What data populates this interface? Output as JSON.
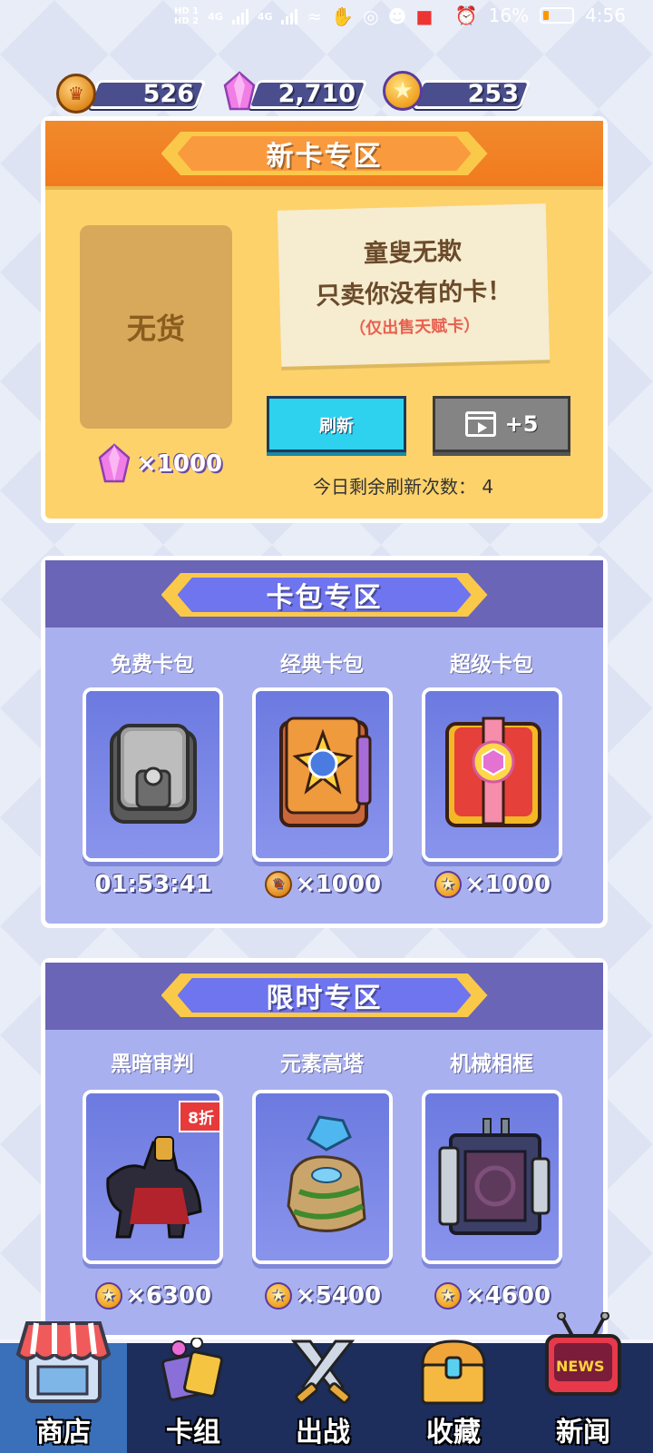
{
  "status_bar": {
    "hd1": "HD 1",
    "hd2": "HD 2",
    "net1": "4G",
    "net2": "4G",
    "battery_percent": "16%",
    "time": "4:56"
  },
  "currencies": {
    "crown_coins": "526",
    "gems": "2,710",
    "star_coins": "253"
  },
  "new_card_zone": {
    "title": "新卡专区",
    "empty_slot_label": "无货",
    "price": "×1000",
    "slogan_line1": "童叟无欺",
    "slogan_line2": "只卖你没有的卡！",
    "slogan_note": "（仅出售天赋卡）",
    "refresh_label": "刷新",
    "video_bonus_label": "+5",
    "refresh_count_text": "今日剩余刷新次数：  4"
  },
  "pack_zone": {
    "title": "卡包专区",
    "packs": [
      {
        "name": "免费卡包",
        "price": "01:53:41",
        "currency_icon": "none"
      },
      {
        "name": "经典卡包",
        "price": "×1000",
        "currency_icon": "crown-coin-icon"
      },
      {
        "name": "超级卡包",
        "price": "×1000",
        "currency_icon": "star-coin-icon"
      }
    ]
  },
  "limited_zone": {
    "title": "限时专区",
    "items": [
      {
        "name": "黑暗审判",
        "price": "×6300",
        "badge": "8折"
      },
      {
        "name": "元素高塔",
        "price": "×5400"
      },
      {
        "name": "机械相框",
        "price": "×4600"
      }
    ]
  },
  "bottom_nav": {
    "items": [
      {
        "label": "商店",
        "icon": "shop-icon"
      },
      {
        "label": "卡组",
        "icon": "deck-icon"
      },
      {
        "label": "出战",
        "icon": "battle-swords-icon"
      },
      {
        "label": "收藏",
        "icon": "treasure-chest-icon"
      },
      {
        "label": "新闻",
        "icon": "news-tv-icon"
      }
    ],
    "news_icon_text": "NEWS"
  },
  "colors": {
    "orange_header": "#f27a1e",
    "orange_body": "#fdd26a",
    "purple_header": "#6a65b6",
    "purple_body": "#a9b0ef",
    "nav_background": "#1d2d5c",
    "refresh_button": "#2ed2ee"
  }
}
